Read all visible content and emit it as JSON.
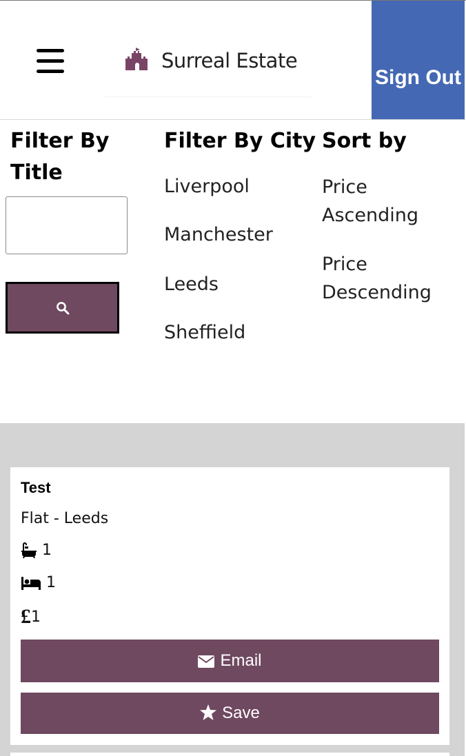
{
  "header": {
    "menu_icon": "hamburger-icon",
    "logo_icon": "castle-icon",
    "logo_text": "Surreal Estate",
    "signout_label": "Sign Out",
    "signout_color": "#4468b3"
  },
  "filters": {
    "title_heading": "Filter By Title",
    "title_input_value": "",
    "search_icon": "search-icon",
    "city_heading": "Filter By City",
    "cities": [
      "Liverpool",
      "Manchester",
      "Leeds",
      "Sheffield"
    ],
    "sort_heading": "Sort by",
    "sort_options": [
      "Price Ascending",
      "Price Descending"
    ],
    "accent_color": "#6f4960"
  },
  "listings": [
    {
      "title": "Test",
      "subtitle": "Flat - Leeds",
      "bathrooms": "1",
      "bathroom_icon": "bath-icon",
      "bedrooms": "1",
      "bedroom_icon": "bed-icon",
      "price_symbol": "£",
      "price": "1",
      "email_label": "Email",
      "email_icon": "envelope-icon",
      "save_label": "Save",
      "save_icon": "star-icon"
    }
  ]
}
